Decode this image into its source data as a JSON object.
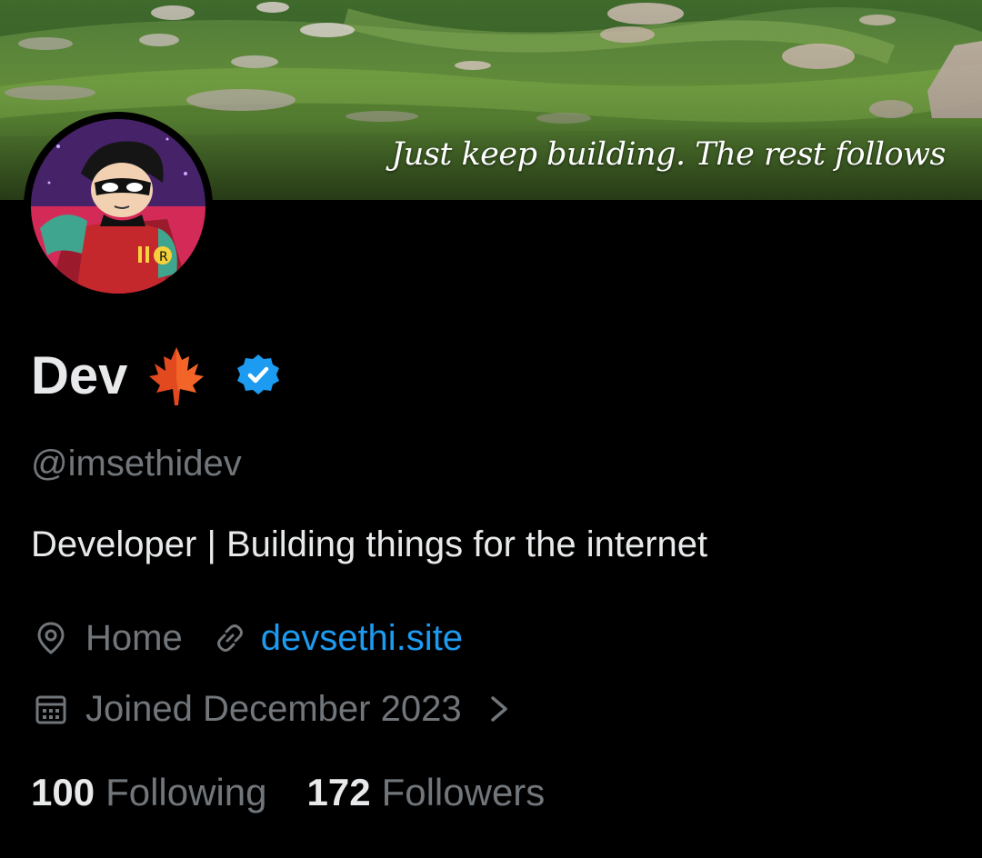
{
  "banner": {
    "quote": "Just keep building. The rest follows"
  },
  "profile": {
    "display_name": "Dev",
    "name_emoji": "maple-leaf",
    "verified": true,
    "handle": "@imsethidev",
    "bio": "Developer | Building things for the internet",
    "location": "Home",
    "website": "devsethi.site",
    "joined": "Joined December 2023"
  },
  "stats": {
    "following_count": "100",
    "following_label": "Following",
    "followers_count": "172",
    "followers_label": "Followers"
  },
  "colors": {
    "background": "#000000",
    "primary_text": "#e7e9ea",
    "secondary_text": "#71767b",
    "link": "#1d9bf0",
    "verified_badge": "#1d9bf0"
  }
}
